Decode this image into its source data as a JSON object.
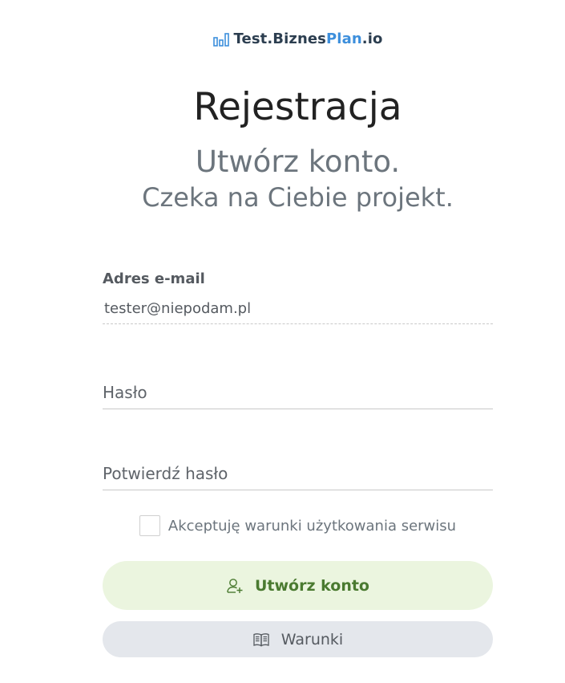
{
  "logo": {
    "text_main": "Test.Biznes",
    "text_accent": "Plan",
    "text_tail": ".io",
    "icon": "bar-chart-icon",
    "accent_color": "#3d8fdc"
  },
  "header": {
    "title": "Rejestracja",
    "subtitle_line1": "Utwórz konto.",
    "subtitle_line2": "Czeka na Ciebie projekt."
  },
  "form": {
    "email_label": "Adres e-mail",
    "email_value": "tester@niepodam.pl",
    "password_placeholder": "Hasło",
    "confirm_password_placeholder": "Potwierdź hasło",
    "terms_label": "Akceptuję warunki użytkowania serwisu",
    "terms_checked": false
  },
  "actions": {
    "create_account_label": "Utwórz konto",
    "create_account_icon": "add-user-icon",
    "create_account_color": "#4a7a30",
    "terms_button_label": "Warunki",
    "terms_button_icon": "book-icon"
  }
}
